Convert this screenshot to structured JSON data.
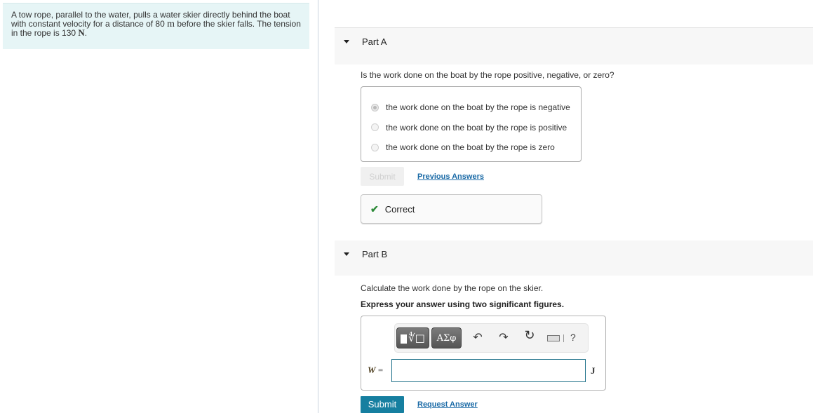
{
  "problem": {
    "text_before_distance": "A tow rope, parallel to the water, pulls a water skier directly behind the boat with constant velocity for a distance of 80 ",
    "distance_unit": "m",
    "text_before_tension": " before the skier falls. The tension in the rope is 130 ",
    "tension_unit": "N",
    "text_end": "."
  },
  "part_a": {
    "title": "Part A",
    "caret_icon": "caret-down-icon",
    "question": "Is the work done on the boat by the rope positive, negative, or zero?",
    "choices": [
      {
        "label": "the work done on the boat by the rope is negative",
        "selected": true
      },
      {
        "label": "the work done on the boat by the rope is positive",
        "selected": false
      },
      {
        "label": "the work done on the boat by the rope is zero",
        "selected": false
      }
    ],
    "submit_label": "Submit",
    "submit_disabled": true,
    "previous_answers_label": "Previous Answers",
    "feedback": {
      "icon": "checkmark-icon",
      "text": "Correct",
      "color": "#2e8b3a"
    }
  },
  "part_b": {
    "title": "Part B",
    "caret_icon": "caret-down-icon",
    "question": "Calculate the work done by the rope on the skier.",
    "instruction": "Express your answer using two significant figures.",
    "toolbar": {
      "templates_icon": "templates-root-icon",
      "symbols_label": "ΑΣφ",
      "undo_icon": "undo-icon",
      "redo_icon": "redo-icon",
      "reset_icon": "reset-icon",
      "keyboard_icon": "keyboard-icon",
      "help_label": "?"
    },
    "variable": "W",
    "equals": "=",
    "input_value": "",
    "unit": "J",
    "submit_label": "Submit",
    "request_answer_label": "Request Answer",
    "submit_color": "#167fa0"
  }
}
